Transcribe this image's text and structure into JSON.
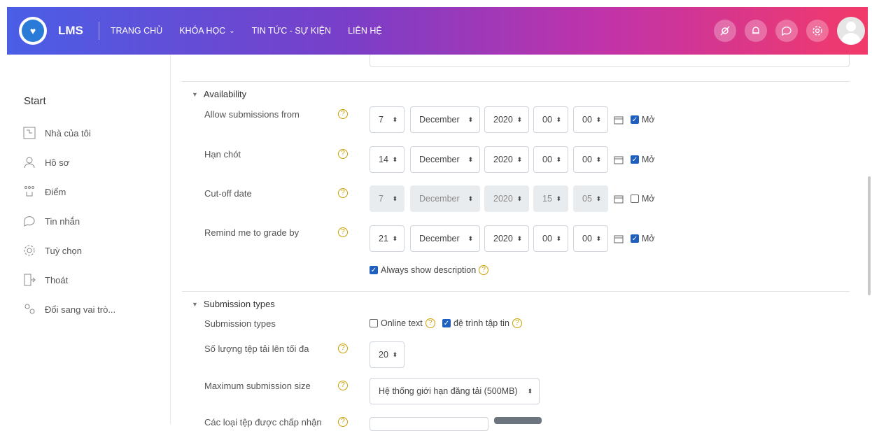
{
  "navbar": {
    "brand": "LMS",
    "links": [
      "TRANG CHỦ",
      "KHÓA HỌC",
      "TIN TỨC - SỰ KIỆN",
      "LIÊN HỆ"
    ],
    "icons": [
      "eye-slash-icon",
      "bell-icon",
      "chat-icon",
      "gear-icon"
    ]
  },
  "sidebar": {
    "title": "Start",
    "items": [
      {
        "label": "Nhà của tôi",
        "icon": "dashboard-icon"
      },
      {
        "label": "Hồ sơ",
        "icon": "profile-icon"
      },
      {
        "label": "Điểm",
        "icon": "grades-icon"
      },
      {
        "label": "Tin nhắn",
        "icon": "message-icon"
      },
      {
        "label": "Tuỳ chọn",
        "icon": "gear-icon"
      },
      {
        "label": "Thoát",
        "icon": "logout-icon"
      },
      {
        "label": "Đổi sang vai trò...",
        "icon": "switch-role-icon"
      }
    ]
  },
  "availability": {
    "heading": "Availability",
    "rows": [
      {
        "label": "Allow submissions from",
        "day": "7",
        "month": "December",
        "year": "2020",
        "hour": "00",
        "minute": "00",
        "enable_label": "Mở",
        "enabled": true
      },
      {
        "label": "Hạn chót",
        "day": "14",
        "month": "December",
        "year": "2020",
        "hour": "00",
        "minute": "00",
        "enable_label": "Mở",
        "enabled": true
      },
      {
        "label": "Cut-off date",
        "day": "7",
        "month": "December",
        "year": "2020",
        "hour": "15",
        "minute": "05",
        "enable_label": "Mở",
        "enabled": false
      },
      {
        "label": "Remind me to grade by",
        "day": "21",
        "month": "December",
        "year": "2020",
        "hour": "00",
        "minute": "00",
        "enable_label": "Mở",
        "enabled": true
      }
    ],
    "always_show": "Always show description"
  },
  "submission": {
    "heading": "Submission types",
    "types_label": "Submission types",
    "online_text": "Online text",
    "file_submission": "đệ trình tập tin",
    "max_files_label": "Số lượng tệp tải lên tối đa",
    "max_files_value": "20",
    "max_size_label": "Maximum submission size",
    "max_size_value": "Hệ thống giới hạn đăng tải (500MB)",
    "accepted_types_label": "Các loại tệp được chấp nhận"
  }
}
